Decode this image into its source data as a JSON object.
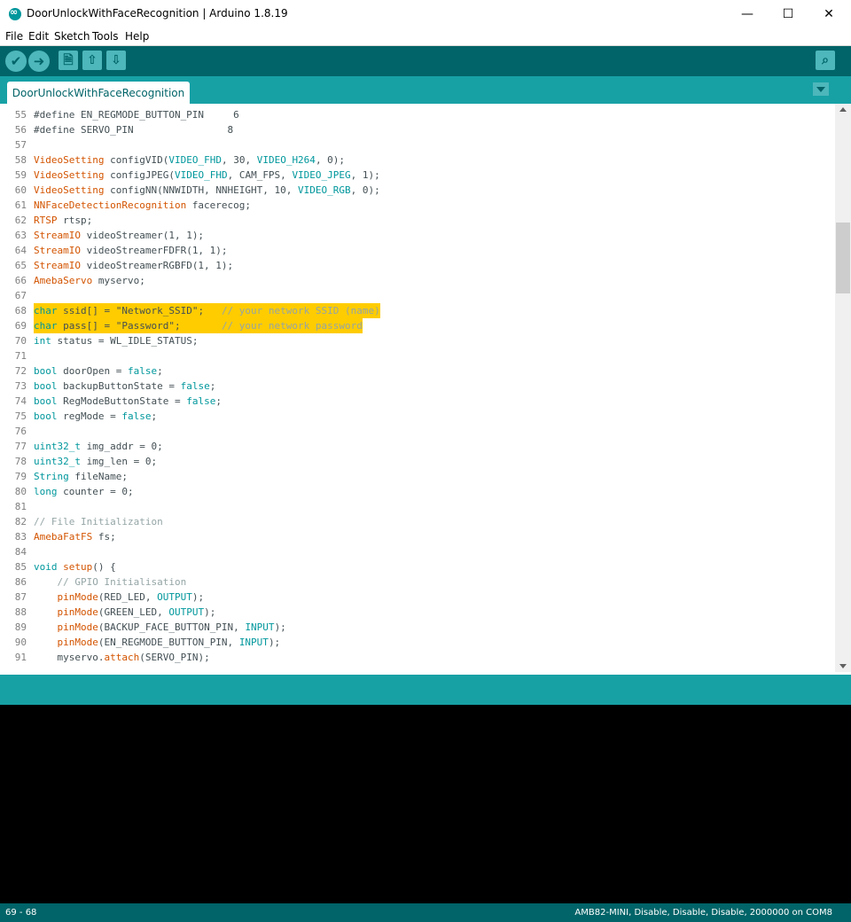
{
  "window": {
    "title": "DoorUnlockWithFaceRecognition | Arduino 1.8.19",
    "controls": {
      "minimize": "—",
      "maximize": "☐",
      "close": "✕"
    }
  },
  "menubar": {
    "items": [
      "File",
      "Edit",
      "Sketch",
      "Tools",
      "Help"
    ]
  },
  "toolbar": {
    "verify_icon": "✔",
    "upload_icon": "➜",
    "new_icon": "🗎",
    "open_icon": "⇧",
    "save_icon": "⇩",
    "serial_monitor_icon": "⌕"
  },
  "tabs": [
    {
      "label": "DoorUnlockWithFaceRecognition"
    }
  ],
  "colors": {
    "accent": "#00979c",
    "toolbar": "#006468",
    "keyword": "#d35400",
    "highlight": "#ffcc00"
  },
  "editor": {
    "lines": [
      {
        "n": "55",
        "html": "#define EN_REGMODE_BUTTON_PIN     6"
      },
      {
        "n": "56",
        "html": "#define SERVO_PIN                8"
      },
      {
        "n": "57",
        "html": ""
      },
      {
        "n": "58",
        "html": "<span class=\"k\">VideoSetting</span> configVID(<span class=\"t\">VIDEO_FHD</span>, 30, <span class=\"t\">VIDEO_H264</span>, 0);"
      },
      {
        "n": "59",
        "html": "<span class=\"k\">VideoSetting</span> configJPEG(<span class=\"t\">VIDEO_FHD</span>, CAM_FPS, <span class=\"t\">VIDEO_JPEG</span>, 1);"
      },
      {
        "n": "60",
        "html": "<span class=\"k\">VideoSetting</span> configNN(NNWIDTH, NNHEIGHT, 10, <span class=\"t\">VIDEO_RGB</span>, 0);"
      },
      {
        "n": "61",
        "html": "<span class=\"k\">NNFaceDetectionRecognition</span> facerecog;"
      },
      {
        "n": "62",
        "html": "<span class=\"k\">RTSP</span> rtsp;"
      },
      {
        "n": "63",
        "html": "<span class=\"k\">StreamIO</span> videoStreamer(1, 1);"
      },
      {
        "n": "64",
        "html": "<span class=\"k\">StreamIO</span> videoStreamerFDFR(1, 1);"
      },
      {
        "n": "65",
        "html": "<span class=\"k\">StreamIO</span> videoStreamerRGBFD(1, 1);"
      },
      {
        "n": "66",
        "html": "<span class=\"k\">AmebaServo</span> myservo;"
      },
      {
        "n": "67",
        "html": ""
      },
      {
        "n": "68",
        "html": "<span class=\"t\">char</span> ssid[] = \"Network_SSID\";   <span class=\"c\">// your network SSID (name)</span>",
        "hl": true
      },
      {
        "n": "69",
        "html": "<span class=\"t\">char</span> pass[] = \"Password\";       <span class=\"c\">// your network password</span>",
        "hl": true
      },
      {
        "n": "70",
        "html": "<span class=\"t\">int</span> status = WL_IDLE_STATUS;"
      },
      {
        "n": "71",
        "html": ""
      },
      {
        "n": "72",
        "html": "<span class=\"t\">bool</span> doorOpen = <span class=\"t\">false</span>;"
      },
      {
        "n": "73",
        "html": "<span class=\"t\">bool</span> backupButtonState = <span class=\"t\">false</span>;"
      },
      {
        "n": "74",
        "html": "<span class=\"t\">bool</span> RegModeButtonState = <span class=\"t\">false</span>;"
      },
      {
        "n": "75",
        "html": "<span class=\"t\">bool</span> regMode = <span class=\"t\">false</span>;"
      },
      {
        "n": "76",
        "html": ""
      },
      {
        "n": "77",
        "html": "<span class=\"t\">uint32_t</span> img_addr = 0;"
      },
      {
        "n": "78",
        "html": "<span class=\"t\">uint32_t</span> img_len = 0;"
      },
      {
        "n": "79",
        "html": "<span class=\"t\">String</span> fileName;"
      },
      {
        "n": "80",
        "html": "<span class=\"t\">long</span> counter = 0;"
      },
      {
        "n": "81",
        "html": ""
      },
      {
        "n": "82",
        "html": "<span class=\"c\">// File Initialization</span>"
      },
      {
        "n": "83",
        "html": "<span class=\"k\">AmebaFatFS</span> fs;"
      },
      {
        "n": "84",
        "html": ""
      },
      {
        "n": "85",
        "html": "<span class=\"t\">void</span> <span class=\"k\">setup</span>() {"
      },
      {
        "n": "86",
        "html": "    <span class=\"c\">// GPIO Initialisation</span>"
      },
      {
        "n": "87",
        "html": "    <span class=\"k\">pinMode</span>(RED_LED, <span class=\"t\">OUTPUT</span>);"
      },
      {
        "n": "88",
        "html": "    <span class=\"k\">pinMode</span>(GREEN_LED, <span class=\"t\">OUTPUT</span>);"
      },
      {
        "n": "89",
        "html": "    <span class=\"k\">pinMode</span>(BACKUP_FACE_BUTTON_PIN, <span class=\"t\">INPUT</span>);"
      },
      {
        "n": "90",
        "html": "    <span class=\"k\">pinMode</span>(EN_REGMODE_BUTTON_PIN, <span class=\"t\">INPUT</span>);"
      },
      {
        "n": "91",
        "html": "    myservo.<span class=\"k\">attach</span>(SERVO_PIN);"
      }
    ]
  },
  "status": {
    "left": "69 - 68",
    "right": "AMB82-MINI, Disable, Disable, Disable, 2000000 on COM8"
  }
}
